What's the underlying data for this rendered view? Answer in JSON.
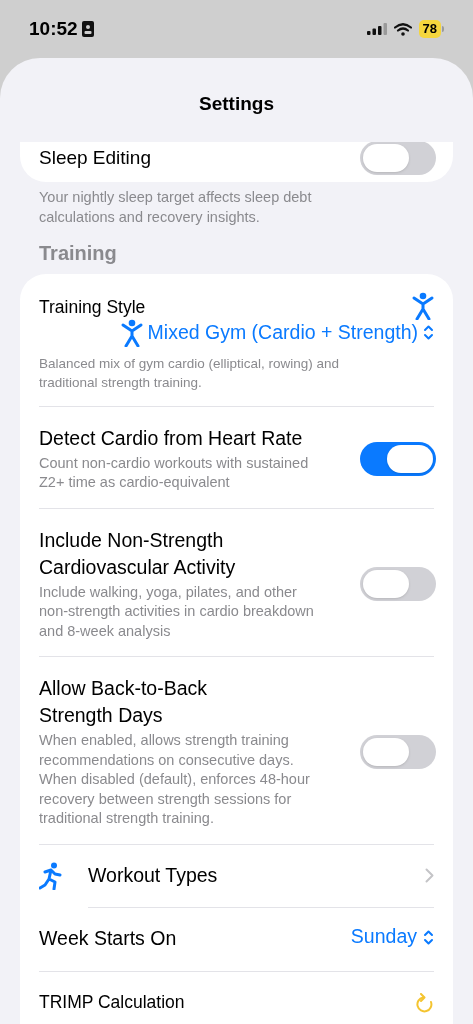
{
  "status_bar": {
    "time": "10:52",
    "battery": "78"
  },
  "title": "Settings",
  "sleep_card": {
    "label": "Sleep Editing",
    "on": false
  },
  "sleep_footer": "Your nightly sleep target affects sleep debt calculations and recovery insights.",
  "section": "Training",
  "rows": [
    {
      "kind": "picker",
      "label": "Training Style",
      "value": "Mixed Gym (Cardio + Strength)",
      "description": "Balanced mix of gym cardio (elliptical, rowing) and traditional strength training."
    },
    {
      "kind": "toggle",
      "label": "Detect Cardio from Heart Rate",
      "description": "Count non-cardio workouts with sustained Z2+ time as cardio-equivalent",
      "on": true
    },
    {
      "kind": "toggle",
      "label": "Include Non-Strength Cardiovascular Activity",
      "description": "Include walking, yoga, pilates, and other non-strength activities in cardio breakdown and 8-week analysis",
      "on": false
    },
    {
      "kind": "toggle",
      "label": "Allow Back-to-Back Strength Days",
      "description": "When enabled, allows strength training recommendations on consecutive days. When disabled (default), enforces 48-hour recovery between strength sessions for traditional strength training.",
      "on": false
    },
    {
      "kind": "link",
      "label": "Workout Types"
    },
    {
      "kind": "menu",
      "label": "Week Starts On",
      "value": "Sunday"
    },
    {
      "kind": "action",
      "label": "TRIMP Calculation"
    }
  ]
}
